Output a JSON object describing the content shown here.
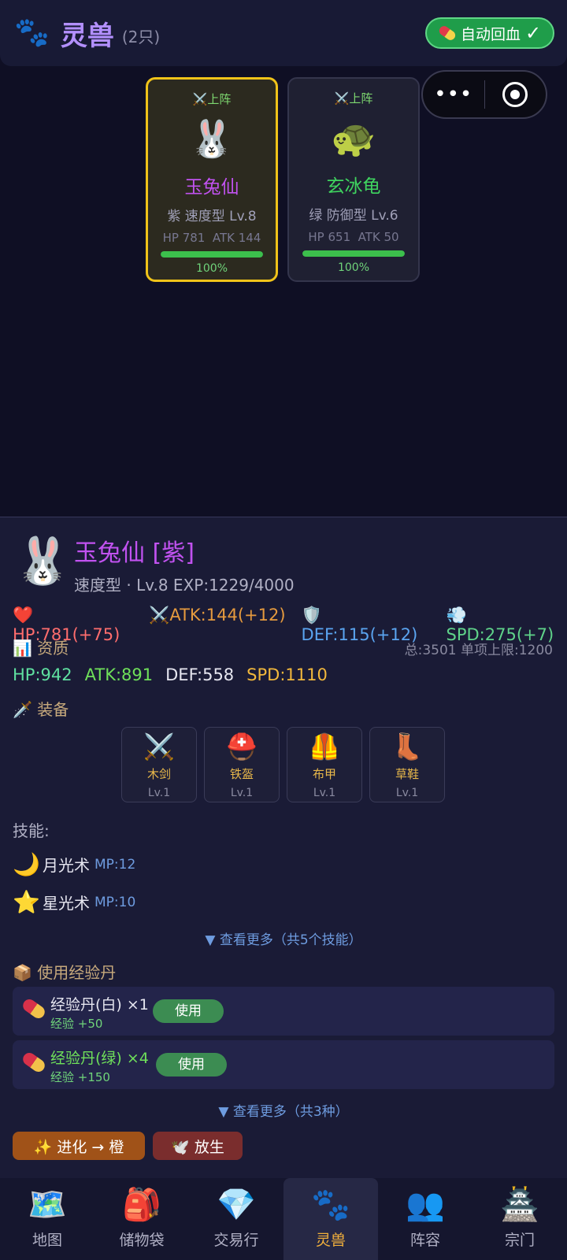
{
  "header": {
    "paw_icon": "🐾",
    "title": "灵兽",
    "count": "(2只)",
    "auto_heal": "自动回血",
    "auto_heal_check": "✓"
  },
  "capsule": {
    "more": "•••"
  },
  "pets": [
    {
      "deploy": "⚔️上阵",
      "emoji": "🐰",
      "name": "玉兔仙",
      "name_color": "#c152f0",
      "info": "紫 速度型 Lv.8",
      "stats": "HP 781  ATK 144",
      "hp_fraction": 1.0,
      "pct": "100%"
    },
    {
      "deploy": "⚔️上阵",
      "emoji": "🐢",
      "name": "玄冰龟",
      "name_color": "#3fd45f",
      "info": "绿 防御型 Lv.6",
      "stats": "HP 651  ATK 50",
      "hp_fraction": 1.0,
      "pct": "100%"
    }
  ],
  "detail": {
    "emoji": "🐰",
    "name": "玉兔仙 [紫]",
    "sub": "速度型 · Lv.8 EXP:1229/4000",
    "stats": {
      "hp": "❤️HP:781(+75)",
      "atk": "⚔️ATK:144(+12)",
      "def": "🛡️DEF:115(+12)",
      "spd": "💨SPD:275(+7)"
    },
    "aptitude_title": "📊 资质",
    "aptitude_note": "总:3501 单项上限:1200",
    "aptitude": {
      "hp": "HP:942",
      "atk": "ATK:891",
      "def": "DEF:558",
      "spd": "SPD:1110"
    },
    "equip_title": "🗡️ 装备",
    "equipment": [
      {
        "icon": "⚔️",
        "name": "木剑",
        "lv": "Lv.1"
      },
      {
        "icon": "⛑️",
        "name": "铁盔",
        "lv": "Lv.1"
      },
      {
        "icon": "🦺",
        "name": "布甲",
        "lv": "Lv.1"
      },
      {
        "icon": "👢",
        "name": "草鞋",
        "lv": "Lv.1"
      }
    ],
    "skills_title": "技能:",
    "skills": [
      {
        "icon": "🌙",
        "name": "月光术",
        "mp": "MP:12"
      },
      {
        "icon": "⭐",
        "name": "星光术",
        "mp": "MP:10"
      }
    ],
    "skills_more": "▼ 查看更多（共5个技能）",
    "exp_title": "📦 使用经验丹",
    "exp_items": [
      {
        "name": "经验丹(白) ×1",
        "name_color": "#e6e6f0",
        "exp": "经验 +50",
        "button": "使用"
      },
      {
        "name": "经验丹(绿) ×4",
        "name_color": "#6fe05a",
        "exp": "经验 +150",
        "button": "使用"
      }
    ],
    "exp_more": "▼ 查看更多（共3种）",
    "evolve": "✨ 进化 → 橙",
    "release": "🕊️ 放生"
  },
  "nav": [
    {
      "icon": "🗺️",
      "label": "地图",
      "active": false
    },
    {
      "icon": "🎒",
      "label": "储物袋",
      "active": false
    },
    {
      "icon": "💎",
      "label": "交易行",
      "active": false
    },
    {
      "icon": "🐾",
      "label": "灵兽",
      "active": true
    },
    {
      "icon": "👥",
      "label": "阵容",
      "active": false
    },
    {
      "icon": "🏯",
      "label": "宗门",
      "active": false
    }
  ]
}
